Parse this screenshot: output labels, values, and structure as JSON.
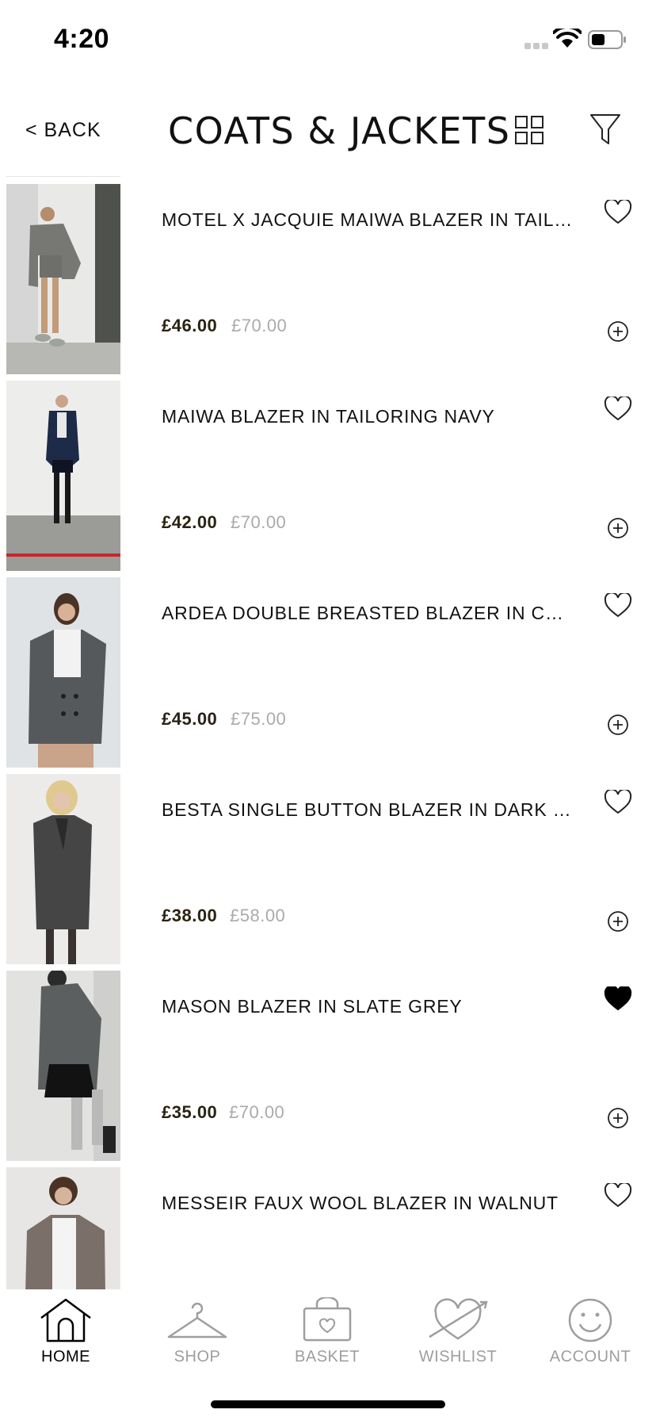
{
  "status_bar": {
    "time": "4:20"
  },
  "header": {
    "back_label": "< BACK",
    "title": "COATS & JACKETS"
  },
  "products": [
    {
      "name": "MOTEL X JACQUIE MAIWA BLAZER IN TAILO...",
      "price": "£46.00",
      "was_price": "£70.00",
      "wishlisted": false
    },
    {
      "name": "MAIWA BLAZER IN TAILORING NAVY",
      "price": "£42.00",
      "was_price": "£70.00",
      "wishlisted": false
    },
    {
      "name": "ARDEA DOUBLE BREASTED BLAZER IN CHA...",
      "price": "£45.00",
      "was_price": "£75.00",
      "wishlisted": false
    },
    {
      "name": "BESTA SINGLE BUTTON BLAZER IN DARK C...",
      "price": "£38.00",
      "was_price": "£58.00",
      "wishlisted": false
    },
    {
      "name": "MASON BLAZER IN SLATE GREY",
      "price": "£35.00",
      "was_price": "£70.00",
      "wishlisted": true
    },
    {
      "name": "MESSEIR FAUX WOOL BLAZER IN WALNUT",
      "price": "",
      "was_price": "",
      "wishlisted": false
    }
  ],
  "tabs": [
    {
      "label": "HOME",
      "icon": "home-icon",
      "active": true
    },
    {
      "label": "SHOP",
      "icon": "hanger-icon",
      "active": false
    },
    {
      "label": "BASKET",
      "icon": "basket-icon",
      "active": false
    },
    {
      "label": "WISHLIST",
      "icon": "heart-arrow-icon",
      "active": false
    },
    {
      "label": "ACCOUNT",
      "icon": "smiley-icon",
      "active": false
    }
  ],
  "colors": {
    "price_now": "#2a2212",
    "price_was": "#aaaaaa",
    "tab_inactive": "#9e9e9e",
    "tab_active": "#000000"
  }
}
